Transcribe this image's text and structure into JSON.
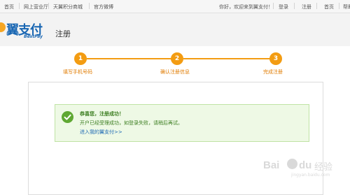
{
  "topbar": {
    "left_links": [
      "首页",
      "网上营业厅",
      "天翼积分商城",
      "官方微博"
    ],
    "welcome": "你好，欢迎来到翼支付！",
    "right_links": [
      "登录",
      "注册",
      "首页",
      "帮助"
    ]
  },
  "header": {
    "logo_text": "翼支付",
    "logo_sub": "BestPay",
    "page_title": "注册"
  },
  "steps": [
    {
      "number": "1",
      "label": "填写手机号码"
    },
    {
      "number": "2",
      "label": "确认注册信息"
    },
    {
      "number": "3",
      "label": "完成注册"
    }
  ],
  "success": {
    "title": "恭喜您，注册成功！",
    "message": "开户已经受理成功，如登录失败，请稍后再试。",
    "link": "进入我的翼支付>>"
  },
  "watermark": {
    "brand_left": "Bai",
    "brand_right": "du",
    "brand_cn": "经验",
    "url": "jingyan.baidu.com"
  },
  "colors": {
    "accent": "#f39c12",
    "brand_blue": "#1a67b3",
    "success_green": "#5fa833",
    "success_bg": "#eef9e5"
  }
}
